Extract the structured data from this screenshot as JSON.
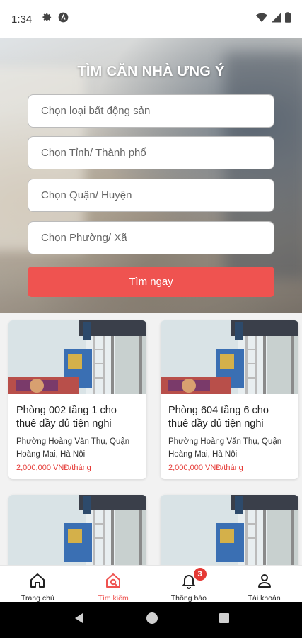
{
  "status_bar": {
    "time": "1:34",
    "left_icons": [
      "gear-icon",
      "a-circle-icon"
    ],
    "right_icons": [
      "wifi-icon",
      "signal-icon",
      "battery-icon"
    ]
  },
  "hero": {
    "title": "TÌM CĂN NHÀ ƯNG Ý",
    "selects": [
      {
        "placeholder": "Chọn loại bất động sản"
      },
      {
        "placeholder": "Chọn Tỉnh/ Thành phố"
      },
      {
        "placeholder": "Chọn Quận/ Huyện"
      },
      {
        "placeholder": "Chọn Phường/ Xã"
      }
    ],
    "search_label": "Tìm ngay"
  },
  "listings": [
    {
      "title": " Phòng 002  tầng 1 cho thuê đầy đủ tiện nghi",
      "address": "Phường Hoàng Văn Thụ, Quận Hoàng Mai, Hà Nội",
      "price": "2,000,000 VNĐ/tháng"
    },
    {
      "title": " Phòng 604  tầng 6 cho thuê đầy đủ tiện nghi",
      "address": "Phường Hoàng Văn Thụ, Quận Hoàng Mai, Hà Nội",
      "price": "2,000,000 VNĐ/tháng"
    },
    {
      "title": "",
      "address": "",
      "price": ""
    },
    {
      "title": "",
      "address": "",
      "price": ""
    }
  ],
  "bottom_nav": {
    "items": [
      {
        "label": "Trang chủ",
        "icon": "home-icon",
        "active": false
      },
      {
        "label": "Tìm kiếm",
        "icon": "home-search-icon",
        "active": true
      },
      {
        "label": "Thông báo",
        "icon": "bell-icon",
        "active": false,
        "badge": "3"
      },
      {
        "label": "Tài khoản",
        "icon": "user-icon",
        "active": false
      }
    ]
  },
  "colors": {
    "accent": "#ef5350",
    "price": "#e53935",
    "nav_bar": "#000000"
  }
}
